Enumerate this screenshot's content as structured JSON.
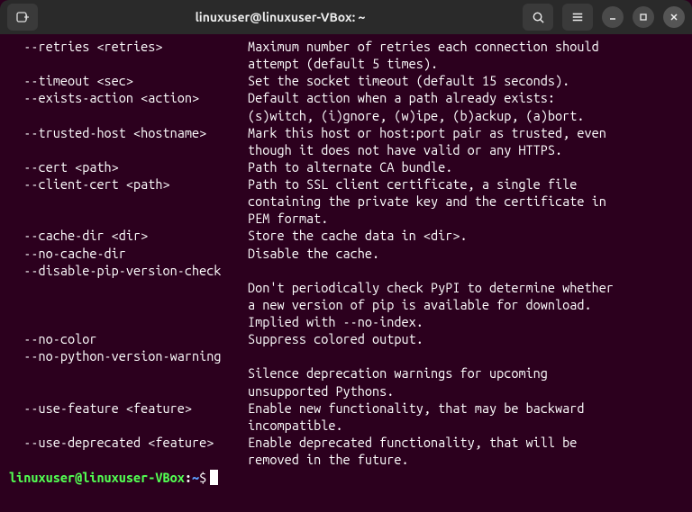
{
  "titlebar": {
    "title": "linuxuser@linuxuser-VBox: ~"
  },
  "options": [
    {
      "flag": "  --retries <retries>",
      "desc": "Maximum number of retries each connection should\nattempt (default 5 times)."
    },
    {
      "flag": "  --timeout <sec>",
      "desc": "Set the socket timeout (default 15 seconds)."
    },
    {
      "flag": "  --exists-action <action>",
      "desc": "Default action when a path already exists:\n(s)witch, (i)gnore, (w)ipe, (b)ackup, (a)bort."
    },
    {
      "flag": "  --trusted-host <hostname>",
      "desc": "Mark this host or host:port pair as trusted, even\nthough it does not have valid or any HTTPS."
    },
    {
      "flag": "  --cert <path>",
      "desc": "Path to alternate CA bundle."
    },
    {
      "flag": "  --client-cert <path>",
      "desc": "Path to SSL client certificate, a single file\ncontaining the private key and the certificate in\nPEM format."
    },
    {
      "flag": "  --cache-dir <dir>",
      "desc": "Store the cache data in <dir>."
    },
    {
      "flag": "  --no-cache-dir",
      "desc": "Disable the cache."
    },
    {
      "flag": "  --disable-pip-version-check",
      "desc": "\nDon't periodically check PyPI to determine whether\na new version of pip is available for download.\nImplied with --no-index."
    },
    {
      "flag": "  --no-color",
      "desc": "Suppress colored output."
    },
    {
      "flag": "  --no-python-version-warning",
      "desc": "\nSilence deprecation warnings for upcoming\nunsupported Pythons."
    },
    {
      "flag": "  --use-feature <feature>",
      "desc": "Enable new functionality, that may be backward\nincompatible."
    },
    {
      "flag": "  --use-deprecated <feature>",
      "desc": "Enable deprecated functionality, that will be\nremoved in the future."
    }
  ],
  "prompt": {
    "user": "linuxuser@linuxuser-VBox",
    "colon": ":",
    "path": "~",
    "dollar": "$"
  }
}
